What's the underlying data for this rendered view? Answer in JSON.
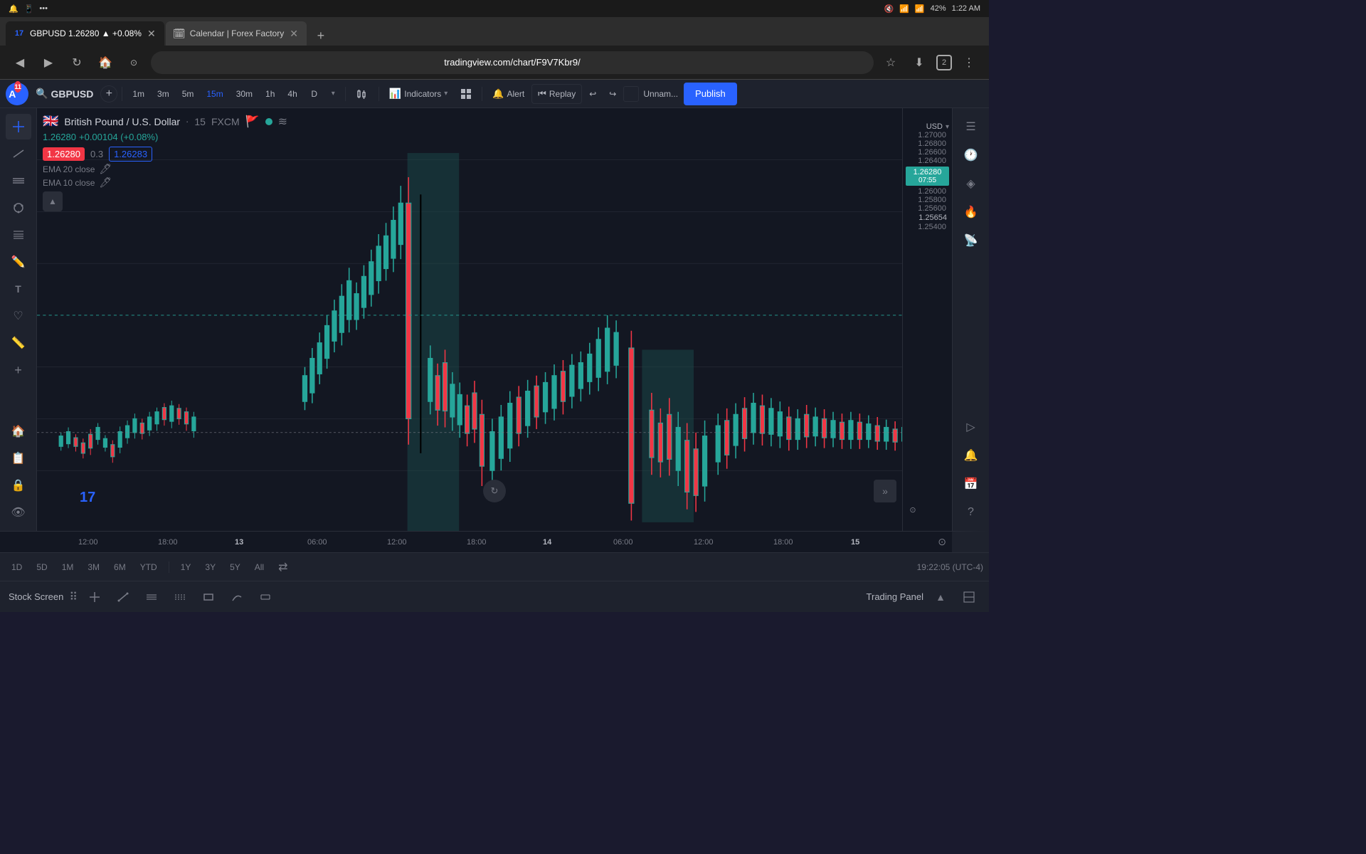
{
  "browser": {
    "status_bar": {
      "time": "1:22 AM",
      "battery": "42%",
      "signal": "4G"
    },
    "tabs": [
      {
        "id": "tv",
        "title": "GBPUSD 1.26280 ▲ +0.08%",
        "active": true,
        "favicon": "tv"
      },
      {
        "id": "ff",
        "title": "Calendar | Forex Factory",
        "active": false,
        "favicon": "ff"
      }
    ],
    "url": "tradingview.com/chart/F9V7Kbr9/"
  },
  "toolbar": {
    "symbol": "GBPUSD",
    "timeframes": [
      "1m",
      "3m",
      "5m",
      "15m",
      "30m",
      "1h",
      "4h",
      "D"
    ],
    "active_timeframe": "15m",
    "indicators_label": "Indicators",
    "alert_label": "Alert",
    "replay_label": "Replay",
    "unnamed_label": "Unnam...",
    "publish_label": "Publish"
  },
  "chart": {
    "symbol": "British Pound / U.S. Dollar",
    "timeframe": "15",
    "broker": "FXCM",
    "price": "1.26280",
    "change": "+0.00104 (+0.08%)",
    "open": "1.26280",
    "spread": "0.3",
    "close": "1.26283",
    "currency": "USD",
    "ema1": "EMA 20 close",
    "ema2": "EMA 10 close",
    "current_price_label": "1.26280",
    "current_time_label": "07:55",
    "lower_price_label": "1.25654",
    "price_levels": [
      "1.27000",
      "1.26800",
      "1.26600",
      "1.26400",
      "1.26000",
      "1.25800",
      "1.25600",
      "1.25400"
    ],
    "time_labels": [
      "12:00",
      "18:00",
      "13",
      "06:00",
      "12:00",
      "18:00",
      "14",
      "06:00",
      "12:00",
      "18:00",
      "15"
    ],
    "periods": [
      "1D",
      "5D",
      "1M",
      "3M",
      "6M",
      "YTD",
      "1Y",
      "3Y",
      "5Y",
      "All"
    ],
    "time_display": "19:22:05 (UTC-4)",
    "tv_logo": "17"
  },
  "bottom_bar": {
    "stock_screen_label": "Stock Screen",
    "trading_panel_label": "Trading Panel"
  },
  "right_sidebar": {
    "tools": [
      "list",
      "clock",
      "layers",
      "fire",
      "broadcast",
      "play",
      "bell",
      "calendar",
      "help"
    ]
  }
}
